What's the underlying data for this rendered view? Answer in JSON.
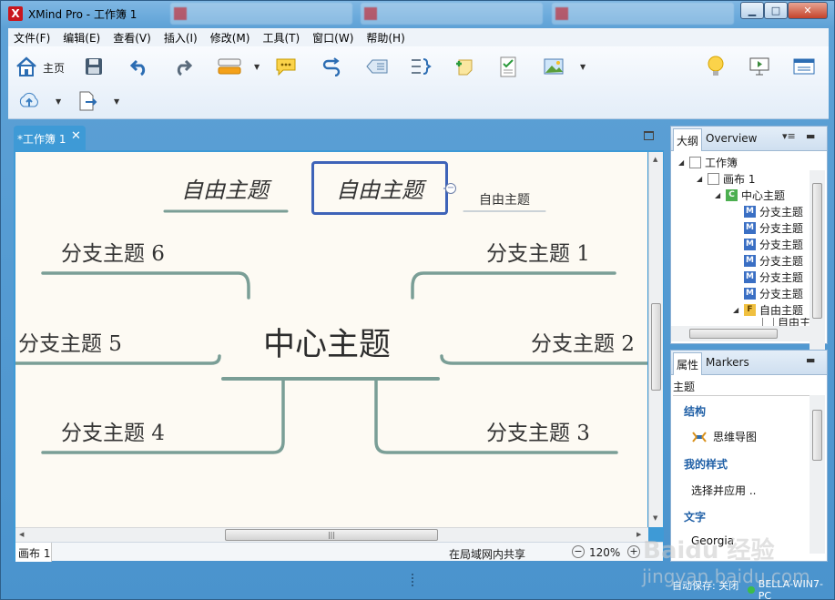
{
  "window": {
    "title": "XMind Pro - 工作簿 1",
    "logo": "X",
    "controls": {
      "minimize": "▁",
      "maximize": "□",
      "close": "✕"
    }
  },
  "menubar": {
    "items": [
      "文件(F)",
      "编辑(E)",
      "查看(V)",
      "插入(I)",
      "修改(M)",
      "工具(T)",
      "窗口(W)",
      "帮助(H)"
    ]
  },
  "toolbar": {
    "home_label": "主页",
    "icons": [
      "home-icon",
      "save-icon",
      "undo-icon",
      "redo-icon",
      "insert-topic-icon",
      "callout-icon",
      "relationship-icon",
      "boundary-icon",
      "summary-icon",
      "note-icon",
      "task-icon",
      "image-icon",
      "brainstorm-icon",
      "presentation-icon",
      "layout-icon",
      "upload-icon",
      "export-icon"
    ]
  },
  "editor": {
    "tab_label": "*工作簿 1",
    "sheet_tab": "画布 1",
    "share_label": "在局域网内共享",
    "zoom_label": "120%"
  },
  "map": {
    "central": "中心主题",
    "branches": [
      "分支主题 1",
      "分支主题 2",
      "分支主题 3",
      "分支主题 4",
      "分支主题 5",
      "分支主题 6"
    ],
    "floating": [
      "自由主题",
      "自由主题"
    ],
    "callout": "自由主题",
    "line_color": "#7a9e96"
  },
  "outline": {
    "tabs": [
      "大纲",
      "Overview"
    ],
    "tree": [
      {
        "label": "工作簿",
        "icon": "doc"
      },
      {
        "label": "画布 1",
        "icon": "doc"
      },
      {
        "label": "中心主题",
        "icon": "C",
        "icon_text": "C"
      },
      {
        "label": "分支主题",
        "icon": "M",
        "icon_text": "M"
      },
      {
        "label": "分支主题",
        "icon": "M",
        "icon_text": "M"
      },
      {
        "label": "分支主题",
        "icon": "M",
        "icon_text": "M"
      },
      {
        "label": "分支主题",
        "icon": "M",
        "icon_text": "M"
      },
      {
        "label": "分支主题",
        "icon": "M",
        "icon_text": "M"
      },
      {
        "label": "分支主题",
        "icon": "M",
        "icon_text": "M"
      },
      {
        "label": "自由主题",
        "icon": "F",
        "icon_text": "F"
      },
      {
        "label": "自由主",
        "icon": "doc"
      }
    ]
  },
  "properties": {
    "tabs": [
      "属性",
      "Markers"
    ],
    "subtitle": "主题",
    "sections": [
      {
        "title": "结构",
        "value": "思维导图"
      },
      {
        "title": "我的样式",
        "value": "选择并应用 .."
      },
      {
        "title": "文字",
        "value": "Georgia"
      }
    ]
  },
  "status": {
    "autosave": "自动保存: 关闭",
    "host": "BELLA-WIN7-PC"
  },
  "watermark": {
    "text": "Baidu 经验",
    "url": "jingyan.baidu.com"
  },
  "colors": {
    "accent": "#3e9ad6",
    "selection": "#3e63b8",
    "canvas": "#fdfaf3"
  }
}
